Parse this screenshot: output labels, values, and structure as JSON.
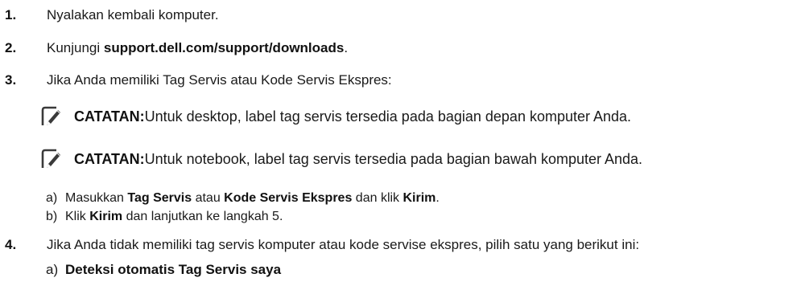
{
  "steps": [
    {
      "num": "1.",
      "parts": [
        {
          "t": "Nyalakan kembali komputer.",
          "b": false
        }
      ]
    },
    {
      "num": "2.",
      "parts": [
        {
          "t": "Kunjungi ",
          "b": false
        },
        {
          "t": "support.dell.com/support/downloads",
          "b": true
        },
        {
          "t": ".",
          "b": false
        }
      ]
    },
    {
      "num": "3.",
      "parts": [
        {
          "t": "Jika Anda memiliki Tag Servis atau Kode Servis Ekspres:",
          "b": false
        }
      ]
    },
    {
      "num": "4.",
      "parts": [
        {
          "t": "Jika Anda tidak memiliki tag servis komputer atau kode servise ekspres, pilih satu yang berikut ini:",
          "b": false
        }
      ]
    }
  ],
  "notes": [
    {
      "label": "CATATAN:",
      "text": " Untuk desktop, label tag servis tersedia pada bagian depan komputer Anda.",
      "icon": "pencil-note-icon"
    },
    {
      "label": "CATATAN:",
      "text": " Untuk notebook, label tag servis tersedia pada bagian bawah komputer Anda.",
      "icon": "pencil-note-icon"
    }
  ],
  "step3_substeps": [
    {
      "letter": "a)",
      "parts": [
        {
          "t": "Masukkan ",
          "b": false
        },
        {
          "t": "Tag Servis",
          "b": true
        },
        {
          "t": " atau ",
          "b": false
        },
        {
          "t": "Kode Servis Ekspres",
          "b": true
        },
        {
          "t": " dan klik ",
          "b": false
        },
        {
          "t": "Kirim",
          "b": true
        },
        {
          "t": ".",
          "b": false
        }
      ]
    },
    {
      "letter": "b)",
      "parts": [
        {
          "t": "Klik ",
          "b": false
        },
        {
          "t": "Kirim",
          "b": true
        },
        {
          "t": " dan lanjutkan ke langkah 5.",
          "b": false
        }
      ]
    }
  ],
  "step4_substeps": [
    {
      "letter": "a)",
      "parts": [
        {
          "t": "Deteksi otomatis Tag Servis saya",
          "b": true
        }
      ]
    }
  ]
}
